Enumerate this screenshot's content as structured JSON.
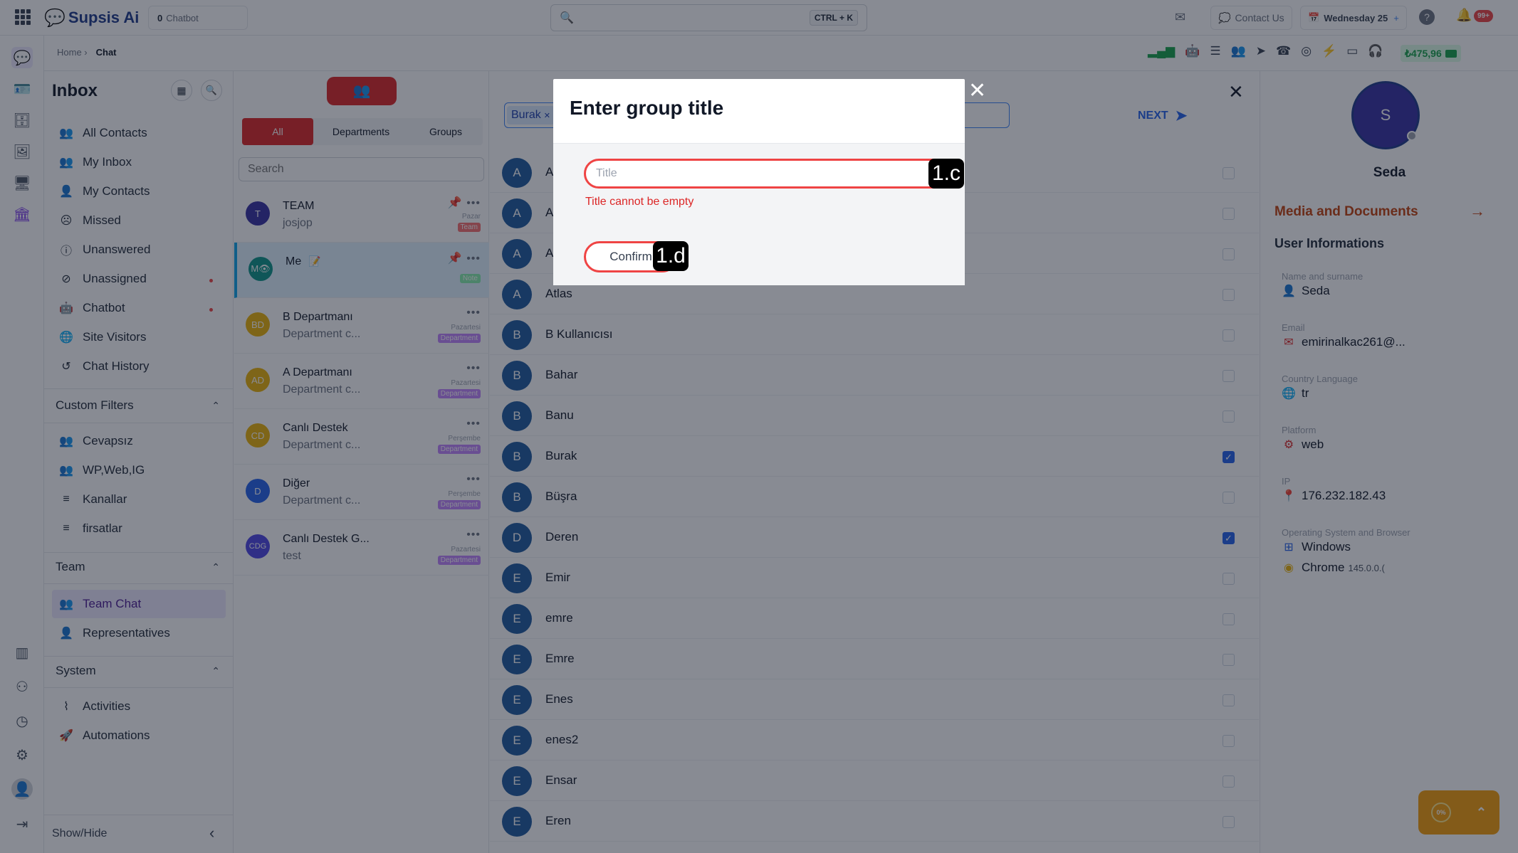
{
  "app": {
    "brand": "Supsis Ai",
    "chatbot_count": "0",
    "chatbot_label": "Chatbot",
    "search_shortcut": "CTRL + K",
    "contact_us": "Contact Us",
    "date_label": "Wednesday 25",
    "notif_badge": "99+",
    "balance": "₺475,96"
  },
  "breadcrumb": {
    "home": "Home ›",
    "current": "Chat"
  },
  "inbox": {
    "title": "Inbox",
    "items": [
      {
        "label": "All Contacts",
        "icon": "users-icon"
      },
      {
        "label": "My Inbox",
        "icon": "users-icon"
      },
      {
        "label": "My Contacts",
        "icon": "user-icon"
      },
      {
        "label": "Missed",
        "icon": "sad-face-icon"
      },
      {
        "label": "Unanswered",
        "icon": "question-icon"
      },
      {
        "label": "Unassigned",
        "icon": "block-icon"
      },
      {
        "label": "Chatbot",
        "icon": "robot-icon"
      },
      {
        "label": "Site Visitors",
        "icon": "globe-icon"
      },
      {
        "label": "Chat History",
        "icon": "history-icon"
      }
    ],
    "custom_filters": {
      "title": "Custom Filters",
      "items": [
        "Cevapsız",
        "WP,Web,IG",
        "Kanallar",
        "firsatlar"
      ]
    },
    "team": {
      "title": "Team",
      "items": [
        "Team Chat",
        "Representatives"
      ]
    },
    "system": {
      "title": "System",
      "items": [
        "Activities",
        "Automations"
      ]
    },
    "show_hide": "Show/Hide"
  },
  "chat_list": {
    "tabs": [
      "All",
      "Departments",
      "Groups"
    ],
    "search_placeholder": "Search",
    "rows": [
      {
        "initials": "T",
        "name": "TEAM",
        "sub": "josjop",
        "day": "Pazar",
        "tag": "Team",
        "color": "#3730a3",
        "tag_color": "#f87171"
      },
      {
        "initials": "M👁",
        "name": "Me",
        "sub": "",
        "day": "",
        "tag": "Note",
        "color": "#0d9488",
        "tag_color": "#86efac"
      },
      {
        "initials": "BD",
        "name": "B Departmanı",
        "sub": "Department c...",
        "day": "Pazartesi",
        "tag": "Department",
        "color": "#eab308",
        "tag_color": "#c084fc"
      },
      {
        "initials": "AD",
        "name": "A Departmanı",
        "sub": "Department c...",
        "day": "Pazartesi",
        "tag": "Department",
        "color": "#eab308",
        "tag_color": "#c084fc"
      },
      {
        "initials": "CD",
        "name": "Canlı Destek",
        "sub": "Department c...",
        "day": "Perşembe",
        "tag": "Department",
        "color": "#eab308",
        "tag_color": "#c084fc"
      },
      {
        "initials": "D",
        "name": "Diğer",
        "sub": "Department c...",
        "day": "Perşembe",
        "tag": "Department",
        "color": "#2563eb",
        "tag_color": "#c084fc"
      },
      {
        "initials": "CDG",
        "name": "Canlı Destek G...",
        "sub": "test",
        "day": "Pazartesi",
        "tag": "Department",
        "color": "#4f46e5",
        "tag_color": "#c084fc"
      }
    ]
  },
  "picker": {
    "selected_chip": "Burak",
    "next_label": "NEXT",
    "contacts": [
      {
        "initial": "A",
        "name": "A",
        "checked": false
      },
      {
        "initial": "A",
        "name": "A",
        "checked": false
      },
      {
        "initial": "A",
        "name": "A",
        "checked": false
      },
      {
        "initial": "A",
        "name": "Atlas",
        "checked": false
      },
      {
        "initial": "B",
        "name": "B Kullanıcısı",
        "checked": false
      },
      {
        "initial": "B",
        "name": "Bahar",
        "checked": false
      },
      {
        "initial": "B",
        "name": "Banu",
        "checked": false
      },
      {
        "initial": "B",
        "name": "Burak",
        "checked": true
      },
      {
        "initial": "B",
        "name": "Büşra",
        "checked": false
      },
      {
        "initial": "D",
        "name": "Deren",
        "checked": true
      },
      {
        "initial": "E",
        "name": "Emir",
        "checked": false
      },
      {
        "initial": "E",
        "name": "emre",
        "checked": false
      },
      {
        "initial": "E",
        "name": "Emre",
        "checked": false
      },
      {
        "initial": "E",
        "name": "Enes",
        "checked": false
      },
      {
        "initial": "E",
        "name": "enes2",
        "checked": false
      },
      {
        "initial": "E",
        "name": "Ensar",
        "checked": false
      },
      {
        "initial": "E",
        "name": "Eren",
        "checked": false
      }
    ]
  },
  "profile": {
    "avatar_initial": "S",
    "name": "Seda",
    "media_title": "Media and Documents",
    "user_info_title": "User Informations",
    "fields": [
      {
        "label": "Name and surname",
        "value": "Seda",
        "icon": "user-icon",
        "icon_color": "#dc2626"
      },
      {
        "label": "Email",
        "value": "emirinalkac261@...",
        "icon": "mail-icon",
        "icon_color": "#dc2626"
      },
      {
        "label": "Country Language",
        "value": "tr",
        "icon": "globe-icon",
        "icon_color": "#dc2626"
      },
      {
        "label": "Platform",
        "value": "web",
        "icon": "gear-icon",
        "icon_color": "#dc2626"
      },
      {
        "label": "IP",
        "value": "176.232.182.43",
        "icon": "pin-icon",
        "icon_color": "#dc2626"
      },
      {
        "label": "Operating System and Browser",
        "value": "Windows",
        "icon": "windows-icon",
        "icon_color": "#2563eb"
      }
    ],
    "browser": "Chrome",
    "browser_version": "145.0.0.(",
    "progress": "0%"
  },
  "modal": {
    "title": "Enter group title",
    "input_placeholder": "Title",
    "input_value": "",
    "error": "Title cannot be empty",
    "confirm": "Confirm",
    "badge_input": "1.c",
    "badge_confirm": "1.d"
  }
}
